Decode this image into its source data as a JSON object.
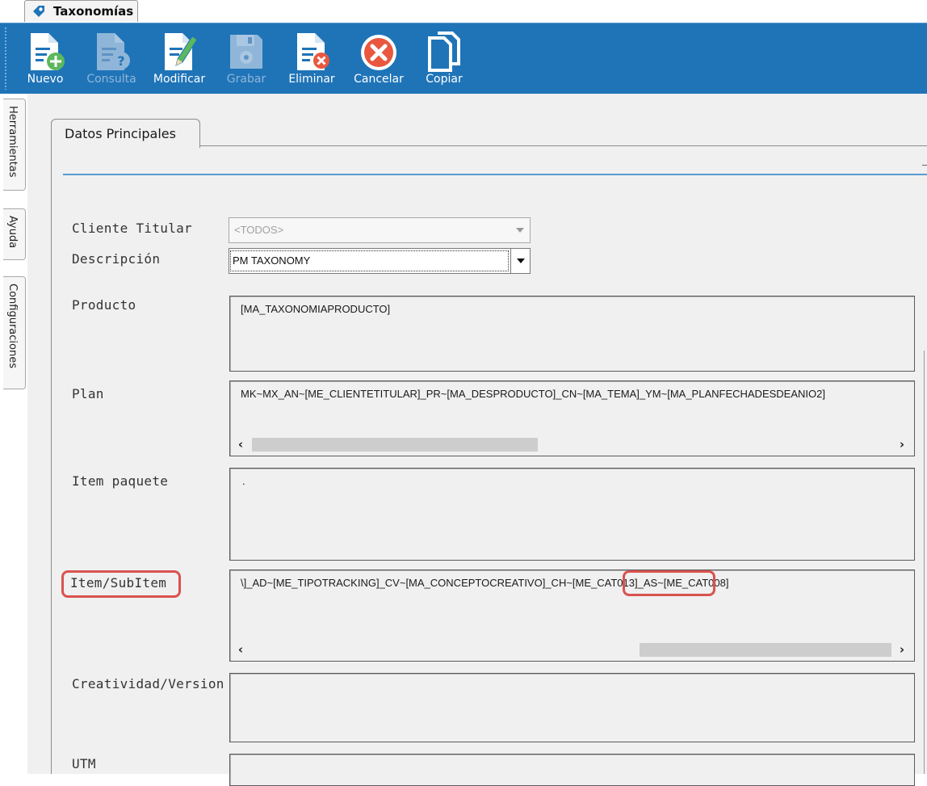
{
  "window_tab": {
    "title": "Taxonomías"
  },
  "toolbar": {
    "nuevo": "Nuevo",
    "consulta": "Consulta",
    "modificar": "Modificar",
    "grabar": "Grabar",
    "eliminar": "Eliminar",
    "cancelar": "Cancelar",
    "copiar": "Copiar"
  },
  "side_tabs": [
    "Herramientas",
    "Ayuda",
    "Configuraciones"
  ],
  "main": {
    "tab": "Datos Principales",
    "fields": {
      "cliente_titular": {
        "label": "Cliente Titular",
        "value": "<TODOS>"
      },
      "descripcion": {
        "label": "Descripción",
        "value": "PM TAXONOMY"
      },
      "producto": {
        "label": "Producto",
        "value": "[MA_TAXONOMIAPRODUCTO]"
      },
      "plan": {
        "label": "Plan",
        "value": "MK~MX_AN~[ME_CLIENTETITULAR]_PR~[MA_DESPRODUCTO]_CN~[MA_TEMA]_YM~[MA_PLANFECHADESDEANIO2]"
      },
      "item_paquete": {
        "label": "Item paquete",
        "value": "."
      },
      "item_subitem": {
        "label": "Item/SubItem",
        "value_prefix": "\\]_AD~[ME_TIPOTRACKING]_CV~[MA_CONCEPTOCREATIVO]_CH~",
        "value_highlight": "[ME_CAT013]",
        "value_suffix": "_AS~[ME_CAT008]"
      },
      "creatividad": {
        "label": "Creatividad/Version",
        "value": ""
      },
      "utm": {
        "label": "UTM",
        "value": ""
      }
    }
  },
  "colors": {
    "toolbar": "#1f74b8",
    "highlight": "#d9534f",
    "panel": "#f0f0f0"
  }
}
